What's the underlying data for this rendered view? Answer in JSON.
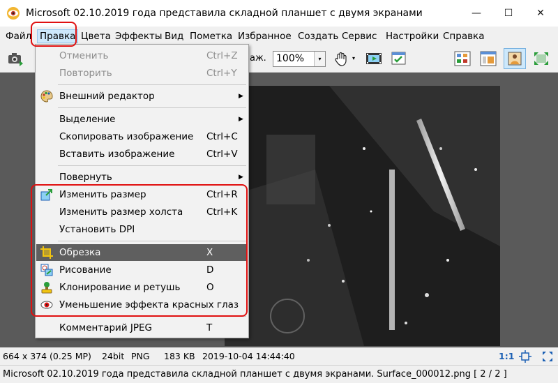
{
  "window": {
    "title": "Microsoft 02.10.2019 года представила складной планшет с двумя экранами. Surface_000...",
    "minimize_glyph": "—",
    "maximize_glyph": "☐",
    "close_glyph": "✕"
  },
  "menubar": [
    {
      "label": "Файл"
    },
    {
      "label": "Правка"
    },
    {
      "label": "Цвета"
    },
    {
      "label": "Эффекты"
    },
    {
      "label": "Вид"
    },
    {
      "label": "Пометка"
    },
    {
      "label": "Избранное"
    },
    {
      "label": "Создать"
    },
    {
      "label": "Сервис"
    },
    {
      "label": "Настройки"
    },
    {
      "label": "Справка"
    }
  ],
  "toolbar": {
    "partial_label": "аж.",
    "zoom_value": "100%",
    "zoom_arrow": "▾"
  },
  "edit_menu": {
    "items": [
      {
        "label": "Отменить",
        "shortcut": "Ctrl+Z"
      },
      {
        "label": "Повторить",
        "shortcut": "Ctrl+Y"
      },
      {
        "label": "Внешний редактор",
        "arrow": "▶"
      },
      {
        "label": "Выделение",
        "arrow": "▶"
      },
      {
        "label": "Скопировать изображение",
        "shortcut": "Ctrl+C"
      },
      {
        "label": "Вставить изображение",
        "shortcut": "Ctrl+V"
      },
      {
        "label": "Повернуть",
        "arrow": "▶"
      },
      {
        "label": "Изменить размер",
        "shortcut": "Ctrl+R"
      },
      {
        "label": "Изменить размер холста",
        "shortcut": "Ctrl+K"
      },
      {
        "label": "Установить DPI"
      },
      {
        "label": "Обрезка",
        "shortcut": "X"
      },
      {
        "label": "Рисование",
        "shortcut": "D"
      },
      {
        "label": "Клонирование и ретушь",
        "shortcut": "O"
      },
      {
        "label": "Уменьшение эффекта красных глаз"
      },
      {
        "label": "Комментарий JPEG",
        "shortcut": "T"
      }
    ]
  },
  "status": {
    "dimensions": "664 x 374 (0.25 MP)",
    "bitdepth": "24bit",
    "format": "PNG",
    "size": "183 KB",
    "datetime": "2019-10-04 14:44:40",
    "ratio": "1:1",
    "filename_line": "Microsoft 02.10.2019 года представила складной планшет с двумя экранами. Surface_000012.png [ 2 / 2 ]"
  },
  "colors": {
    "annotation": "#e01010",
    "highlight": "#5f5f5f",
    "ratio_text": "#1a5fb4"
  }
}
